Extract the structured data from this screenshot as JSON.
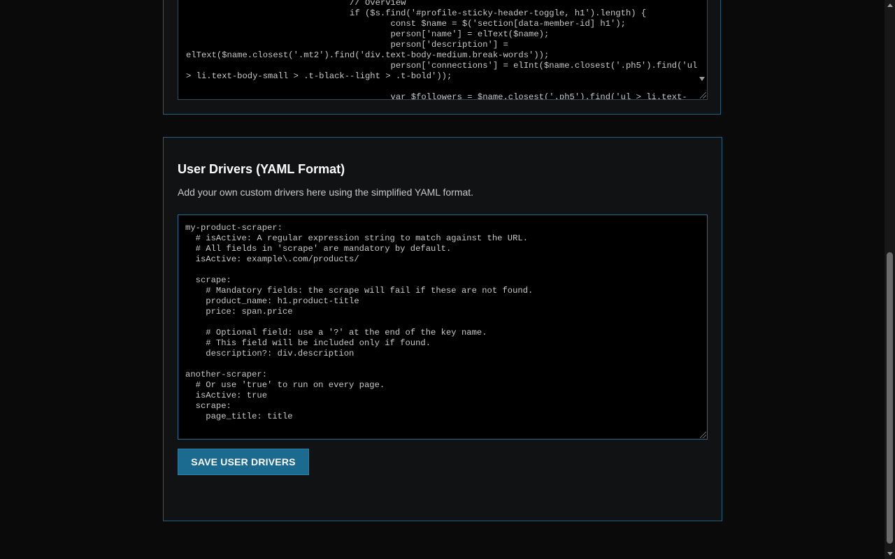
{
  "top_editor": {
    "code": "                                // Overview\n                                if ($s.find('#profile-sticky-header-toggle, h1').length) {\n                                        const $name = $('section[data-member-id] h1');\n                                        person['name'] = elText($name);\n                                        person['description'] =\nelText($name.closest('.mt2').find('div.text-body-medium.break-words'));\n                                        person['connections'] = elInt($name.closest('.ph5').find('ul\n> li.text-body-small > .t-black--light > .t-bold'));\n\n                                        var $followers = $name.closest('.ph5').find('ul > li.text-"
  },
  "user_drivers": {
    "title": "User Drivers (YAML Format)",
    "description": "Add your own custom drivers here using the simplified YAML format.",
    "yaml": "my-product-scraper:\n  # isActive: A regular expression string to match against the URL.\n  # All fields in 'scrape' are mandatory by default.\n  isActive: example\\.com/products/\n\n  scrape:\n    # Mandatory fields: the scrape will fail if these are not found.\n    product_name: h1.product-title\n    price: span.price\n\n    # Optional field: use a '?' at the end of the key name.\n    # This field will be included only if found.\n    description?: div.description\n\nanother-scraper:\n  # Or use 'true' to run on every page.\n  isActive: true\n  scrape:\n    page_title: title",
    "save_label": "SAVE USER DRIVERS"
  },
  "theme": {
    "accent": "#1b6a8f",
    "border": "#1f5f7f",
    "background": "#0a0a0a",
    "panel": "#111214"
  }
}
